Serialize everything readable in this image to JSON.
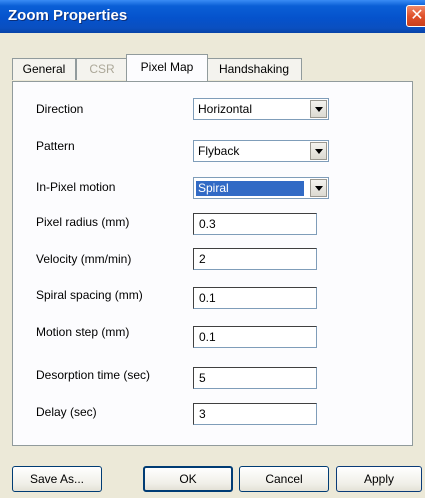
{
  "window": {
    "title": "Zoom Properties",
    "close_glyph": "✕"
  },
  "tabs": [
    {
      "label": "General",
      "active": false,
      "disabled": false
    },
    {
      "label": "CSR",
      "active": false,
      "disabled": true
    },
    {
      "label": "Pixel Map",
      "active": true,
      "disabled": false
    },
    {
      "label": "Handshaking",
      "active": false,
      "disabled": false
    }
  ],
  "form": {
    "direction": {
      "label": "Direction",
      "value": "Horizontal"
    },
    "pattern": {
      "label": "Pattern",
      "value": "Flyback"
    },
    "in_pixel_motion": {
      "label": "In-Pixel motion",
      "value": "Spiral"
    },
    "pixel_radius": {
      "label": "Pixel radius (mm)",
      "value": "0.3"
    },
    "velocity": {
      "label": "Velocity (mm/min)",
      "value": "2"
    },
    "spiral_spacing": {
      "label": "Spiral spacing (mm)",
      "value": "0.1"
    },
    "motion_step": {
      "label": "Motion step (mm)",
      "value": "0.1"
    },
    "desorption_time": {
      "label": "Desorption time (sec)",
      "value": "5"
    },
    "delay": {
      "label": "Delay (sec)",
      "value": "3"
    }
  },
  "buttons": {
    "save_as": "Save As...",
    "ok": "OK",
    "cancel": "Cancel",
    "apply": "Apply"
  }
}
